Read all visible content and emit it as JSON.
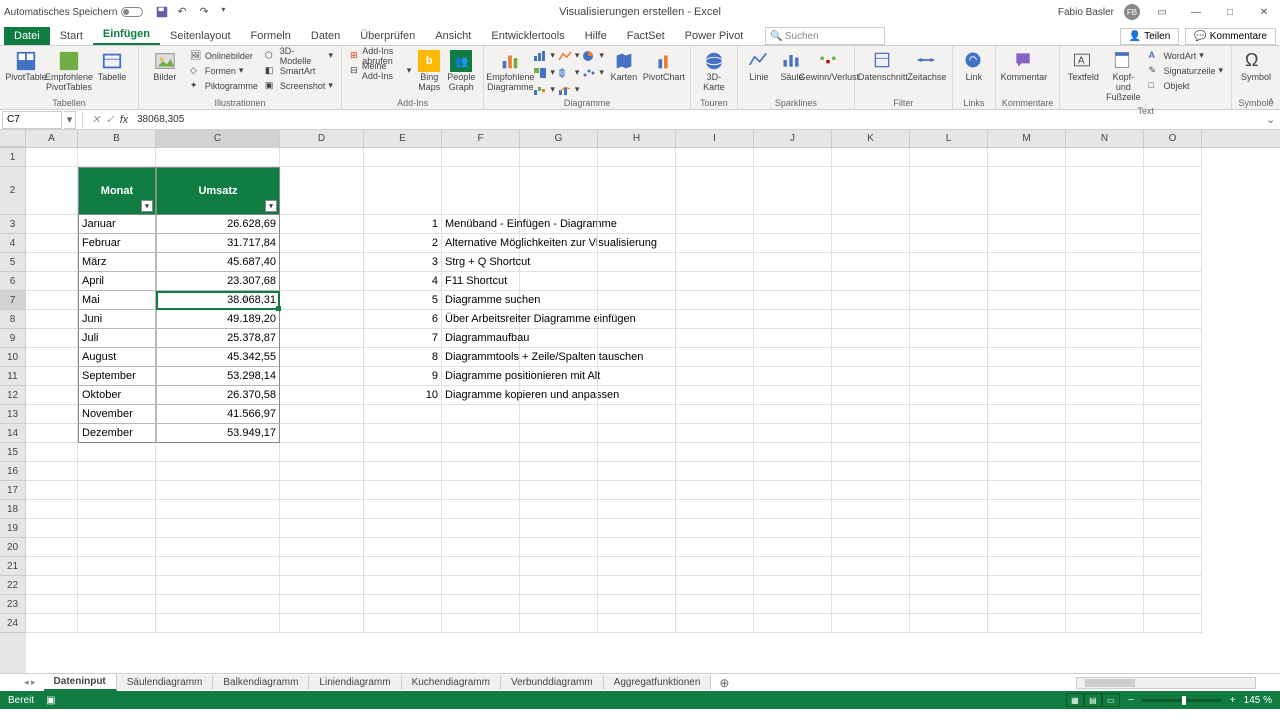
{
  "titlebar": {
    "autosave": "Automatisches Speichern",
    "doc_title": "Visualisierungen erstellen - Excel",
    "user_name": "Fabio Basler",
    "user_initials": "FB"
  },
  "tabs": {
    "file": "Datei",
    "items": [
      "Start",
      "Einfügen",
      "Seitenlayout",
      "Formeln",
      "Daten",
      "Überprüfen",
      "Ansicht",
      "Entwicklertools",
      "Hilfe",
      "FactSet",
      "Power Pivot"
    ],
    "active_index": 1,
    "search_placeholder": "Suchen",
    "share": "Teilen",
    "comments": "Kommentare"
  },
  "ribbon": {
    "groups": {
      "tabellen": {
        "label": "Tabellen",
        "pivot": "PivotTable",
        "empf": "Empfohlene PivotTables",
        "tabelle": "Tabelle"
      },
      "illustrationen": {
        "label": "Illustrationen",
        "bilder": "Bilder",
        "online": "Onlinebilder",
        "formen": "Formen",
        "pikto": "Piktogramme",
        "models": "3D-Modelle",
        "smartart": "SmartArt",
        "screenshot": "Screenshot"
      },
      "addins": {
        "label": "Add-Ins",
        "get": "Add-Ins abrufen",
        "mine": "Meine Add-Ins",
        "bing": "Bing Maps",
        "people": "People Graph"
      },
      "diagramme": {
        "label": "Diagramme",
        "empf": "Empfohlene Diagramme",
        "karten": "Karten",
        "pivotchart": "PivotChart"
      },
      "touren": {
        "label": "Touren",
        "karte": "3D-Karte"
      },
      "sparklines": {
        "label": "Sparklines",
        "linie": "Linie",
        "saule": "Säule",
        "gv": "Gewinn/Verlust"
      },
      "filter": {
        "label": "Filter",
        "daten": "Datenschnitt",
        "zeit": "Zeitachse"
      },
      "links": {
        "label": "Links",
        "link": "Link"
      },
      "kommentare": {
        "label": "Kommentare",
        "kommentar": "Kommentar"
      },
      "text": {
        "label": "Text",
        "textfeld": "Textfeld",
        "kopf": "Kopf- und Fußzeile",
        "wordart": "WordArt",
        "sig": "Signaturzeile",
        "objekt": "Objekt"
      },
      "symbole": {
        "label": "Symbole",
        "symbol": "Symbol"
      }
    }
  },
  "formula_bar": {
    "name_box": "C7",
    "formula": "38068,305"
  },
  "columns": [
    "A",
    "B",
    "C",
    "D",
    "E",
    "F",
    "G",
    "H",
    "I",
    "J",
    "K",
    "L",
    "M",
    "N",
    "O"
  ],
  "table": {
    "headers": {
      "month": "Monat",
      "revenue": "Umsatz"
    },
    "rows": [
      {
        "m": "Januar",
        "u": "26.628,69"
      },
      {
        "m": "Februar",
        "u": "31.717,84"
      },
      {
        "m": "März",
        "u": "45.687,40"
      },
      {
        "m": "April",
        "u": "23.307,68"
      },
      {
        "m": "Mai",
        "u": "38.068,31"
      },
      {
        "m": "Juni",
        "u": "49.189,20"
      },
      {
        "m": "Juli",
        "u": "25.378,87"
      },
      {
        "m": "August",
        "u": "45.342,55"
      },
      {
        "m": "September",
        "u": "53.298,14"
      },
      {
        "m": "Oktober",
        "u": "26.370,58"
      },
      {
        "m": "November",
        "u": "41.566,97"
      },
      {
        "m": "Dezember",
        "u": "53.949,17"
      }
    ]
  },
  "notes": [
    {
      "n": "1",
      "t": "Menüband - Einfügen - Diagramme"
    },
    {
      "n": "2",
      "t": "Alternative Möglichkeiten zur Visualisierung"
    },
    {
      "n": "3",
      "t": "Strg + Q Shortcut"
    },
    {
      "n": "4",
      "t": "F11 Shortcut"
    },
    {
      "n": "5",
      "t": "Diagramme suchen"
    },
    {
      "n": "6",
      "t": "Über Arbeitsreiter Diagramme einfügen"
    },
    {
      "n": "7",
      "t": "Diagrammaufbau"
    },
    {
      "n": "8",
      "t": "Diagrammtools + Zeile/Spalten tauschen"
    },
    {
      "n": "9",
      "t": "Diagramme positionieren mit Alt"
    },
    {
      "n": "10",
      "t": "Diagramme kopieren und anpassen"
    }
  ],
  "sheets": {
    "items": [
      "Dateninput",
      "Säulendiagramm",
      "Balkendiagramm",
      "Liniendiagramm",
      "Kuchendiagramm",
      "Verbunddiagramm",
      "Aggregatfunktionen"
    ],
    "active_index": 0
  },
  "statusbar": {
    "ready": "Bereit",
    "zoom": "145 %"
  },
  "active_cell": "C7"
}
